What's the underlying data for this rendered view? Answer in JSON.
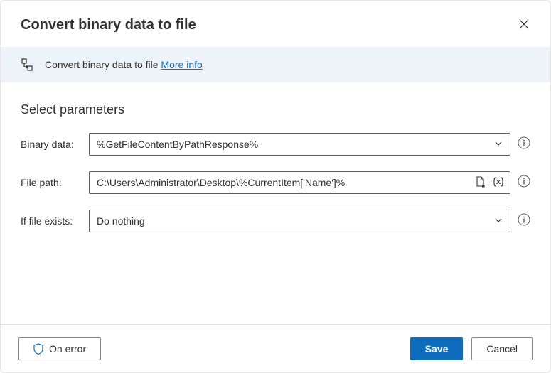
{
  "header": {
    "title": "Convert binary data to file"
  },
  "info_bar": {
    "text": "Convert binary data to file",
    "link_label": "More info"
  },
  "section_title": "Select parameters",
  "fields": {
    "binary_data": {
      "label": "Binary data:",
      "value": "%GetFileContentByPathResponse%"
    },
    "file_path": {
      "label": "File path:",
      "value": "C:\\Users\\Administrator\\Desktop\\%CurrentItem['Name']%"
    },
    "if_file_exists": {
      "label": "If file exists:",
      "value": "Do nothing"
    }
  },
  "footer": {
    "on_error": "On error",
    "save": "Save",
    "cancel": "Cancel"
  }
}
